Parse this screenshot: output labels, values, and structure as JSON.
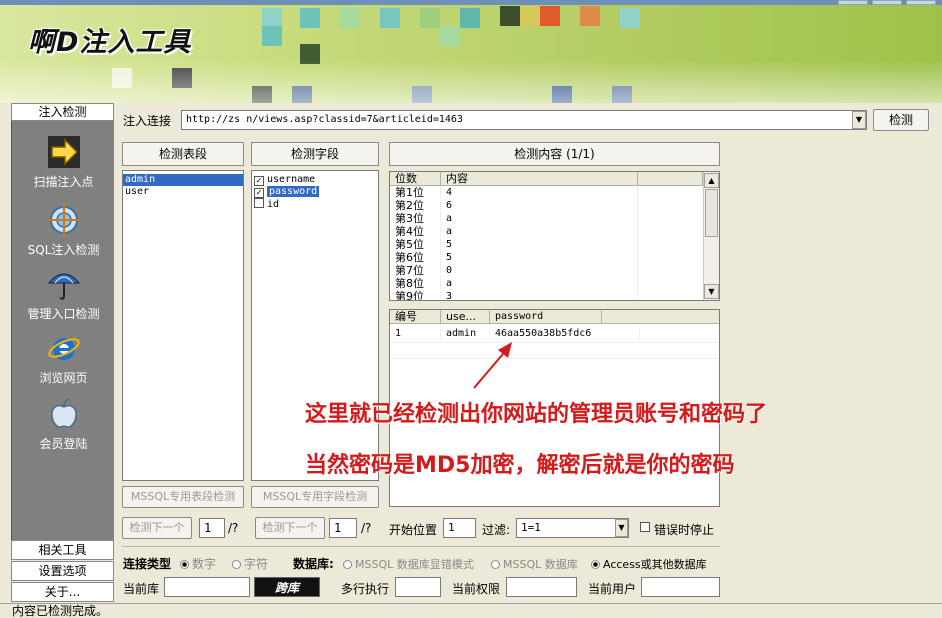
{
  "app": {
    "title": "啊D注入工具"
  },
  "sidebar": {
    "header_tab": "注入检测",
    "items": [
      {
        "label": "扫描注入点",
        "icon": "arrow-right-icon"
      },
      {
        "label": "SQL注入检测",
        "icon": "target-icon"
      },
      {
        "label": "管理入口检测",
        "icon": "umbrella-icon"
      },
      {
        "label": "浏览网页",
        "icon": "ie-browser-icon"
      },
      {
        "label": "会员登陆",
        "icon": "apple-icon"
      }
    ],
    "bottom": [
      "相关工具",
      "设置选项",
      "关于..."
    ]
  },
  "url_bar": {
    "label": "注入连接",
    "value": "http://zs        n/views.asp?classid=7&articleid=1463",
    "detect_button": "检测"
  },
  "tables_panel": {
    "header": "检测表段",
    "items": [
      "admin",
      "user"
    ],
    "selected": 0,
    "mssql_button": "MSSQL专用表段检测",
    "next_button": "检测下一个",
    "page_value": "1",
    "page_total": "/?"
  },
  "fields_panel": {
    "header": "检测字段",
    "items": [
      {
        "name": "username",
        "checked": true
      },
      {
        "name": "password",
        "checked": true
      },
      {
        "name": "id",
        "checked": false
      }
    ],
    "selected": 1,
    "mssql_button": "MSSQL专用字段检测",
    "next_button": "检测下一个",
    "page_value": "1",
    "page_total": "/?"
  },
  "content_panel": {
    "header": "检测内容  (1/1)",
    "pos_columns": [
      "位数",
      "内容"
    ],
    "pos_rows": [
      [
        "第1位",
        "4"
      ],
      [
        "第2位",
        "6"
      ],
      [
        "第3位",
        "a"
      ],
      [
        "第4位",
        "a"
      ],
      [
        "第5位",
        "5"
      ],
      [
        "第6位",
        "5"
      ],
      [
        "第7位",
        "0"
      ],
      [
        "第8位",
        "a"
      ],
      [
        "第9位",
        "3"
      ]
    ],
    "result_columns": [
      "编号",
      "use...",
      "password"
    ],
    "result_rows": [
      [
        "1",
        "admin",
        "46aa550a38b5fdc6"
      ]
    ]
  },
  "annotation": {
    "line1": "这里就已经检测出你网站的管理员账号和密码了",
    "line2": "当然密码是MD5加密，解密后就是你的密码"
  },
  "controls": {
    "start_pos_label": "开始位置",
    "start_pos_value": "1",
    "filter_label": "过滤:",
    "filter_value": "1=1",
    "stop_on_error_label": "错误时停止"
  },
  "connection": {
    "type_label": "连接类型",
    "type_options": [
      "数字",
      "字符"
    ],
    "db_label": "数据库:",
    "db_options": [
      "MSSQL 数据库显错模式",
      "MSSQL 数据库",
      "Access或其他数据库"
    ],
    "db_selected": 2,
    "current_db_label": "当前库",
    "cross_db_button": "跨库",
    "multi_exec_label": "多行执行",
    "current_perm_label": "当前权限",
    "current_user_label": "当前用户"
  },
  "status": {
    "text": "内容已检测完成。"
  },
  "colors": {
    "annotation": "#d41a1a",
    "selection": "#316ac5",
    "sidebar": "#808080"
  }
}
